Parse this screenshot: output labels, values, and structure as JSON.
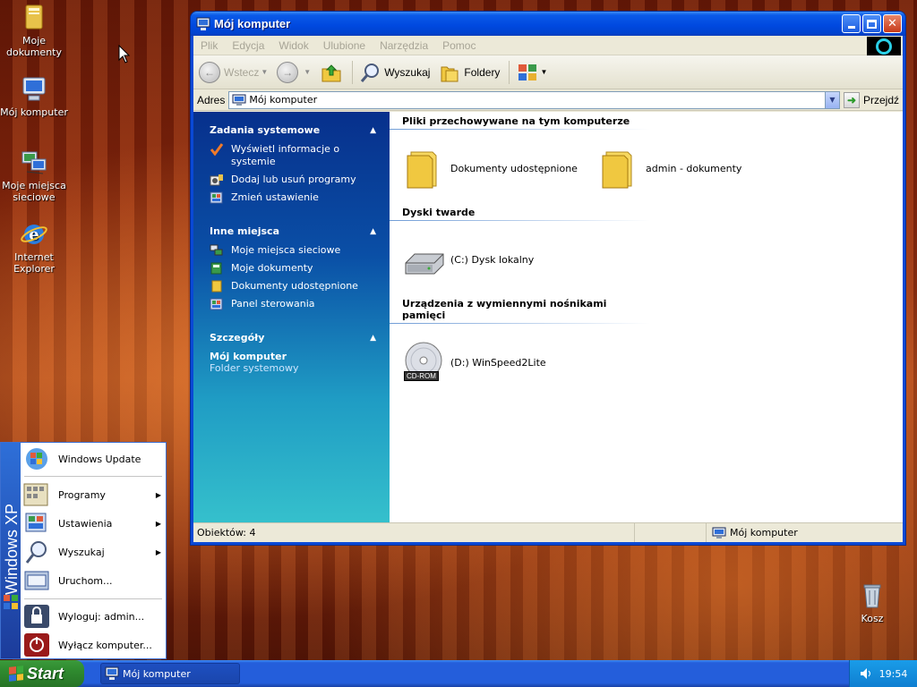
{
  "desktop": {
    "icons": [
      {
        "label_line1": "Moje",
        "label_line2": "dokumenty",
        "icon": "folder-documents-icon"
      },
      {
        "label_line1": "Mój komputer",
        "label_line2": "",
        "icon": "computer-icon"
      },
      {
        "label_line1": "Moje miejsca",
        "label_line2": "sieciowe",
        "icon": "network-places-icon"
      },
      {
        "label_line1": "Internet",
        "label_line2": "Explorer",
        "icon": "internet-explorer-icon"
      },
      {
        "label_line1": "Kosz",
        "label_line2": "",
        "icon": "recycle-bin-icon"
      }
    ]
  },
  "window": {
    "title": "Mój komputer",
    "menu": [
      "Plik",
      "Edycja",
      "Widok",
      "Ulubione",
      "Narzędzia",
      "Pomoc"
    ],
    "toolbar": {
      "back": "Wstecz",
      "search": "Wyszukaj",
      "folders": "Foldery"
    },
    "address": {
      "label": "Adres",
      "value": "Mój komputer",
      "go": "Przejdź"
    },
    "tasks": {
      "system": {
        "title": "Zadania systemowe",
        "items": [
          "Wyświetl informacje o systemie",
          "Dodaj lub usuń programy",
          "Zmień ustawienie"
        ]
      },
      "other": {
        "title": "Inne miejsca",
        "items": [
          "Moje miejsca sieciowe",
          "Moje dokumenty",
          "Dokumenty udostępnione",
          "Panel sterowania"
        ]
      },
      "details": {
        "title": "Szczegóły",
        "name": "Mój komputer",
        "type": "Folder systemowy"
      }
    },
    "sections": {
      "stored": {
        "title": "Pliki przechowywane na tym komputerze",
        "items": [
          "Dokumenty udostępnione",
          "admin - dokumenty"
        ]
      },
      "hdd": {
        "title": "Dyski twarde",
        "items": [
          "(C:) Dysk lokalny"
        ]
      },
      "removable": {
        "title": "Urządzenia z wymiennymi nośnikami pamięci",
        "items": [
          "(D:) WinSpeed2Lite"
        ],
        "cd_label": "CD-ROM"
      }
    },
    "status": {
      "objects": "Obiektów: 4",
      "location": "Mój komputer"
    }
  },
  "startmenu": {
    "band": "Windows XP",
    "items": [
      "Windows Update",
      "Programy",
      "Ustawienia",
      "Wyszukaj",
      "Uruchom...",
      "Wyloguj: admin...",
      "Wyłącz komputer..."
    ]
  },
  "taskbar": {
    "start": "Start",
    "task": "Mój komputer",
    "clock": "19:54"
  }
}
